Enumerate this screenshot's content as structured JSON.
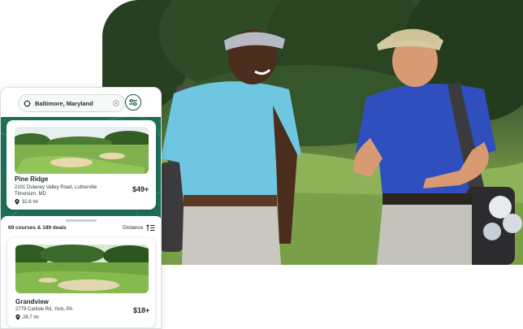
{
  "search": {
    "location_query": "Baltimore, Maryland"
  },
  "map": {
    "featured_course": {
      "name": "Pine Ridge",
      "address_line1": "2101 Dulaney Valley Road, Lutherville",
      "address_line2": "Timonium, MD",
      "distance": "32.6 mi",
      "price": "$49+"
    }
  },
  "results": {
    "summary": "69 courses & 189 deals",
    "sort_label": "Distance",
    "courses": [
      {
        "name": "Grandview",
        "address": "2779 Carlisle Rd, York, PA",
        "distance": "28.7 mi",
        "price": "$18+"
      }
    ]
  },
  "colors": {
    "brand_green": "#0f5a44",
    "map_green": "#1f6e5a",
    "polo_light_blue": "#6ec6e0",
    "polo_royal_blue": "#2f4fbf"
  },
  "icons": {
    "location": "location-icon",
    "clear": "clear-icon",
    "filter": "filter-icon",
    "sort": "sort-icon",
    "pin": "map-pin-icon"
  }
}
